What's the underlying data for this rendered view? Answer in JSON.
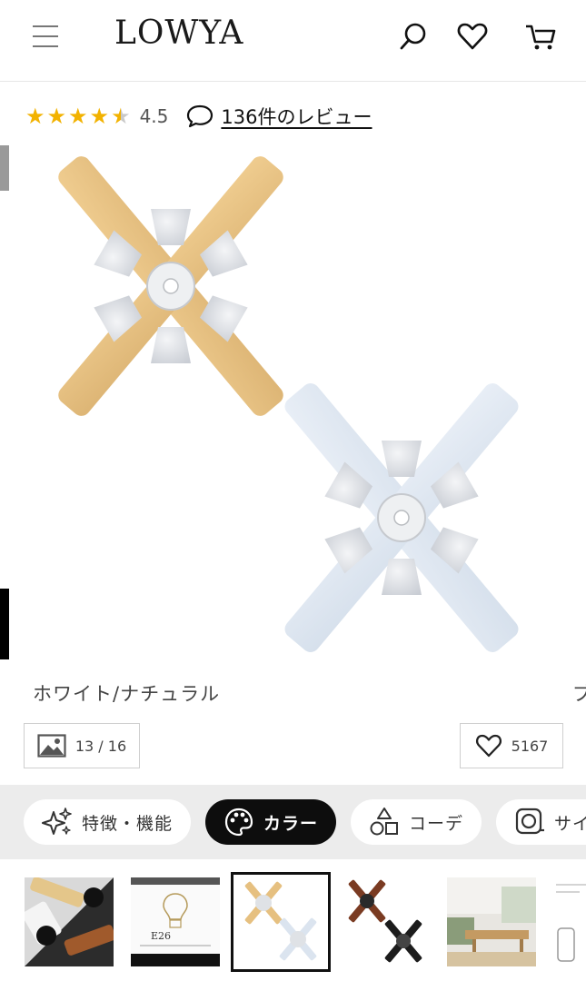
{
  "header": {
    "logo": "LOWYA",
    "icons": [
      "menu-icon",
      "search-icon",
      "heart-icon",
      "cart-icon"
    ]
  },
  "rating": {
    "value": "4.5",
    "stars": 4.5,
    "review_link": "136件のレビュー"
  },
  "product": {
    "color_label": "ホワイト/ナチュラル",
    "next_color_label": "ブ",
    "image_counter": "13 / 16",
    "favorite_count": "5167"
  },
  "tabs": [
    {
      "label": "特徴・機能",
      "icon": "sparkle-icon"
    },
    {
      "label": "カラー",
      "icon": "palette-icon",
      "active": true
    },
    {
      "label": "コーデ",
      "icon": "shapes-icon"
    },
    {
      "label": "サイ",
      "icon": "measure-tape-icon"
    }
  ],
  "thumbnails": [
    {
      "name": "thumb-blade-colors"
    },
    {
      "name": "thumb-e26-bulb",
      "caption": "E26"
    },
    {
      "name": "thumb-white-natural",
      "selected": true
    },
    {
      "name": "thumb-brown-black"
    },
    {
      "name": "thumb-room-scene"
    },
    {
      "name": "thumb-remote"
    }
  ],
  "colors": {
    "star": "#f2b200",
    "natural_wood": "#e8c080",
    "white_blade": "#dde6f0",
    "active_tab": "#0d0d0d"
  }
}
